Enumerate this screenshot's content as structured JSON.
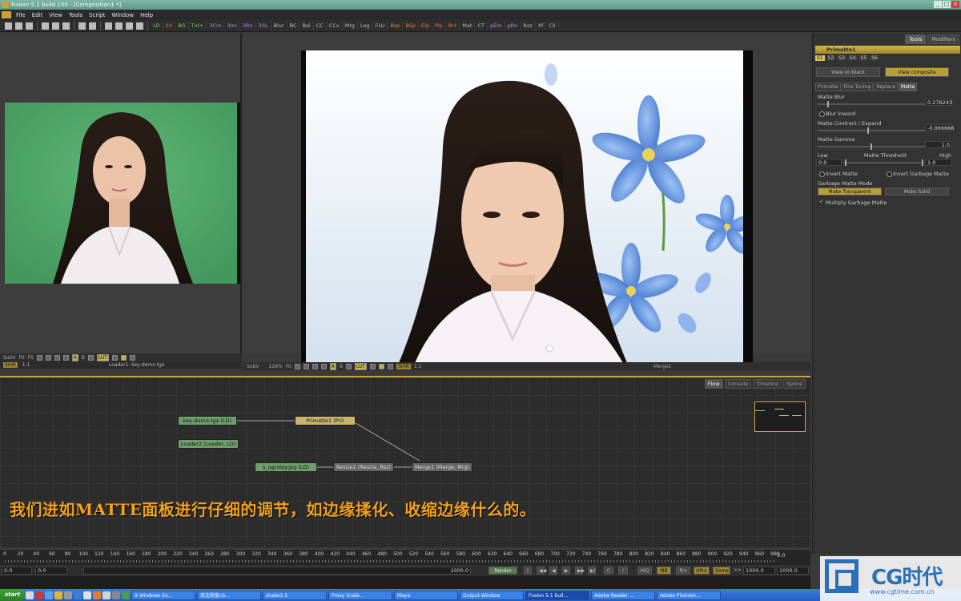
{
  "window": {
    "title": "Fusion 5.1 build 100 - [Composition1 *]",
    "controls": [
      "_",
      "□",
      "×"
    ]
  },
  "menu": [
    "File",
    "Edit",
    "View",
    "Tools",
    "Script",
    "Window",
    "Help"
  ],
  "toolbar": {
    "buttons": [
      {
        "label": "LD",
        "tone": "g"
      },
      {
        "label": "SV",
        "tone": "o"
      },
      {
        "label": "BG",
        "tone": "g"
      },
      {
        "label": "Txt+",
        "tone": "g"
      },
      {
        "label": "3Cm",
        "tone": "p"
      },
      {
        "label": "3Im",
        "tone": "p"
      },
      {
        "label": "3Rn",
        "tone": "p"
      },
      {
        "label": "3SL",
        "tone": "p"
      },
      {
        "label": "Blur",
        "tone": ""
      },
      {
        "label": "BC",
        "tone": ""
      },
      {
        "label": "Bol",
        "tone": ""
      },
      {
        "label": "CC",
        "tone": ""
      },
      {
        "label": "CCv",
        "tone": ""
      },
      {
        "label": "Mrg",
        "tone": ""
      },
      {
        "label": "Log",
        "tone": ""
      },
      {
        "label": "FLU",
        "tone": ""
      },
      {
        "label": "Bsp",
        "tone": "o"
      },
      {
        "label": "BSp",
        "tone": "o"
      },
      {
        "label": "Elp",
        "tone": "o"
      },
      {
        "label": "Ply",
        "tone": "o"
      },
      {
        "label": "Rct",
        "tone": "o"
      },
      {
        "label": "Mat",
        "tone": ""
      },
      {
        "label": "CT",
        "tone": ""
      },
      {
        "label": "pEm",
        "tone": "p"
      },
      {
        "label": "pRn",
        "tone": "p"
      },
      {
        "label": "Rsz",
        "tone": ""
      },
      {
        "label": "Xf",
        "tone": ""
      },
      {
        "label": "Cli",
        "tone": ""
      }
    ]
  },
  "viewer_left": {
    "subv": "SubV",
    "fit1": "Fit",
    "fit2": "Fit",
    "a": "A",
    "b": "B",
    "lut": "LUT",
    "smr": "SmR",
    "ratio": "1:1",
    "caption": "Loader1: key-demo.tga"
  },
  "viewer_right": {
    "subv": "SubV",
    "zoom": "126%",
    "fit": "Fit",
    "a": "A",
    "b": "B",
    "lut": "LUT",
    "smr": "SmR",
    "ratio": "1:1",
    "caption": "Merge1"
  },
  "panel": {
    "tabs": [
      "Tools",
      "Modifiers"
    ],
    "tool_name": "Primatte1",
    "sets": [
      "S1",
      "S2",
      "S3",
      "S4",
      "S5",
      "S6"
    ],
    "view_on_black": "View on black",
    "view_composite": "View composite",
    "subtabs": [
      "Primatte",
      "Fine Tuning",
      "Replace",
      "Matte"
    ],
    "matte_blur_label": "Matte Blur",
    "matte_blur_value": "0.276243",
    "blur_inward": "Blur Inward",
    "contract_label": "Matte Contract / Expand",
    "contract_value": "-0.066666",
    "gamma_label": "Matte Gamma",
    "gamma_value": "1.0",
    "threshold_low": "Low",
    "threshold_label": "Matte Threshold",
    "threshold_high": "High",
    "threshold_low_value": "0.0",
    "threshold_high_value": "1.0",
    "invert_matte": "Invert Matte",
    "invert_garbage": "Invert Garbage Matte",
    "garbage_mode_label": "Garbage Matte Mode",
    "make_transparent": "Make Transparent",
    "make_solid": "Make Solid",
    "multiply_garbage": "Multiply Garbage Matte"
  },
  "flow": {
    "tabs": [
      "Flow",
      "Console",
      "Timeline",
      "Spline"
    ],
    "nodes": {
      "keydemo": "key-demo.tga  (LD)",
      "primatte": "Primatte1  (Pri)",
      "loader2": "Loader2  (Loader, LD)",
      "sugroipy": "s_ugroipy.jpg  (LD)",
      "resize": "Resize1  (Resize, Rsz)",
      "merge": "Merge1  (Merge, Mrg)"
    },
    "subtitle": "我们进如MATTE面板进行仔细的调节，如边缘揉化、收缩边缘什么的。"
  },
  "timeline": {
    "ticks": [
      "0",
      "20",
      "40",
      "60",
      "80",
      "100",
      "120",
      "140",
      "160",
      "180",
      "200",
      "220",
      "240",
      "260",
      "280",
      "300",
      "320",
      "340",
      "360",
      "380",
      "400",
      "420",
      "440",
      "460",
      "480",
      "500",
      "520",
      "540",
      "560",
      "580",
      "600",
      "620",
      "640",
      "660",
      "680",
      "700",
      "720",
      "740",
      "760",
      "780",
      "800",
      "820",
      "840",
      "860",
      "880",
      "900",
      "920",
      "940",
      "960",
      "980"
    ],
    "end": "0.0",
    "start_field": "0.0",
    "current_field": "0.0",
    "range_end": "1000.0",
    "render": "Render",
    "hiq": "HiQ",
    "mb": "MB",
    "prx": "Prx",
    "aprx": "APrx",
    "some": "Some",
    "out1": "1000.0",
    "out2": "1000.0",
    "arrows": ">>"
  },
  "taskbar": {
    "start": "start",
    "tasks": [
      "9 Windows Ex...",
      "双边技能cb...",
      "shake2.5",
      "Proxy Scale...",
      "Maya",
      "Output Window",
      "Fusion 5.1 buil...",
      "Adobe Reader ...",
      "Adobe Photosh..."
    ]
  },
  "watermark": {
    "text": "CG时代",
    "url": "www.cgtime.com.cn"
  },
  "colors": {
    "accent": "#c8a342",
    "subtitle": "#f1a21e",
    "greenscreen": "#4ea86a",
    "flower": "#4a7fd4"
  }
}
